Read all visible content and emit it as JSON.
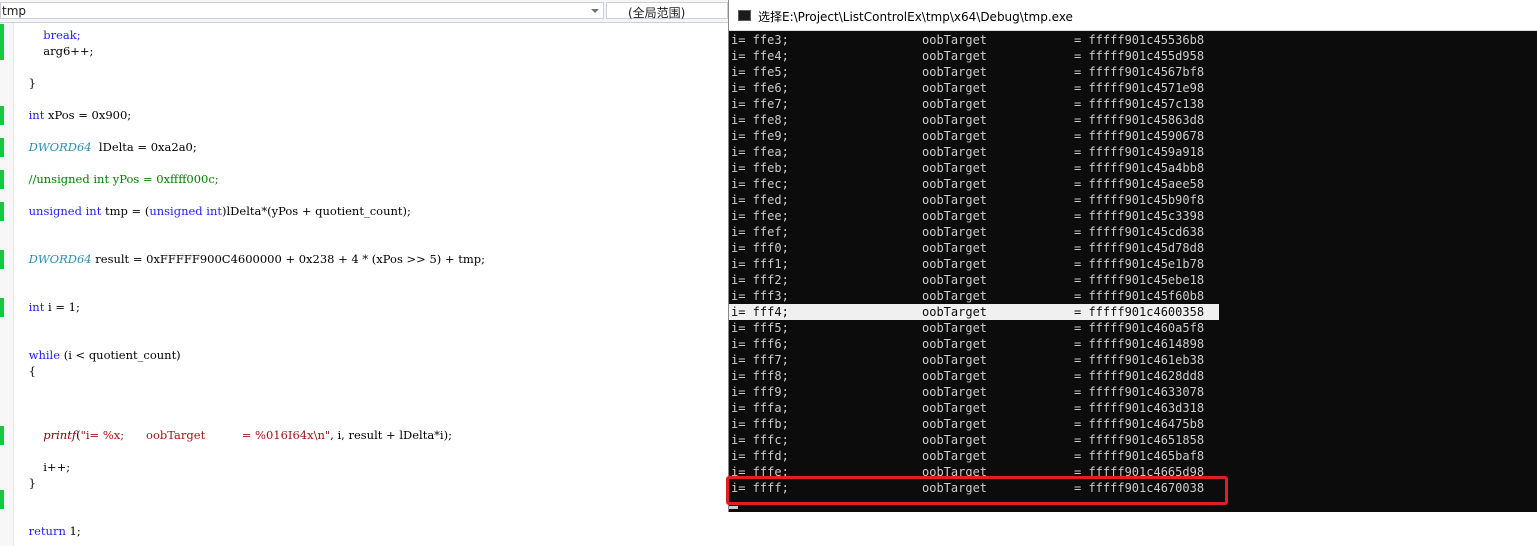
{
  "editor": {
    "file_combo": "tmp",
    "scope_combo": "(全局范围)",
    "code": {
      "break": "break;",
      "arg6": "arg6++;",
      "close_brace_1": "}",
      "xpos_kw": "int",
      "xpos_rest": " xPos = 0x900;",
      "delta_type": "DWORD64",
      "delta_rest": "  lDelta = 0xa2a0;",
      "comment": "//unsigned int yPos = 0xffff000c;",
      "tmp_kw1": "unsigned",
      "tmp_sp1": " ",
      "tmp_kw2": "int",
      "tmp_mid": " tmp = (",
      "tmp_kw3": "unsigned",
      "tmp_sp2": " ",
      "tmp_kw4": "int",
      "tmp_rest": ")lDelta*(yPos + quotient_count);",
      "result_type": "DWORD64",
      "result_rest": " result = 0xFFFFF900C4600000 + 0x238 + 4 * (xPos >> 5) + tmp;",
      "i_kw": "int",
      "i_rest": " i = 1;",
      "while_kw": "while",
      "while_rest": " (i < quotient_count)",
      "open_brace": "{",
      "printf_fn": "printf",
      "printf_open": "(",
      "printf_str": "\"i= %x;      oobTarget          = %016I64x\\n\"",
      "printf_rest": ", i, result + lDelta*i);",
      "incr": "i++;",
      "close_brace_2": "}",
      "return_kw": "return",
      "return_rest": " 1;"
    }
  },
  "console": {
    "title": "选择E:\\Project\\ListControlEx\\tmp\\x64\\Debug\\tmp.exe",
    "lines": [
      {
        "i": "i= ffe3;",
        "label": "oobTarget",
        "value": "= fffff901c45536b8"
      },
      {
        "i": "i= ffe4;",
        "label": "oobTarget",
        "value": "= fffff901c455d958"
      },
      {
        "i": "i= ffe5;",
        "label": "oobTarget",
        "value": "= fffff901c4567bf8"
      },
      {
        "i": "i= ffe6;",
        "label": "oobTarget",
        "value": "= fffff901c4571e98"
      },
      {
        "i": "i= ffe7;",
        "label": "oobTarget",
        "value": "= fffff901c457c138"
      },
      {
        "i": "i= ffe8;",
        "label": "oobTarget",
        "value": "= fffff901c45863d8"
      },
      {
        "i": "i= ffe9;",
        "label": "oobTarget",
        "value": "= fffff901c4590678"
      },
      {
        "i": "i= ffea;",
        "label": "oobTarget",
        "value": "= fffff901c459a918"
      },
      {
        "i": "i= ffeb;",
        "label": "oobTarget",
        "value": "= fffff901c45a4bb8"
      },
      {
        "i": "i= ffec;",
        "label": "oobTarget",
        "value": "= fffff901c45aee58"
      },
      {
        "i": "i= ffed;",
        "label": "oobTarget",
        "value": "= fffff901c45b90f8"
      },
      {
        "i": "i= ffee;",
        "label": "oobTarget",
        "value": "= fffff901c45c3398"
      },
      {
        "i": "i= ffef;",
        "label": "oobTarget",
        "value": "= fffff901c45cd638"
      },
      {
        "i": "i= fff0;",
        "label": "oobTarget",
        "value": "= fffff901c45d78d8"
      },
      {
        "i": "i= fff1;",
        "label": "oobTarget",
        "value": "= fffff901c45e1b78"
      },
      {
        "i": "i= fff2;",
        "label": "oobTarget",
        "value": "= fffff901c45ebe18"
      },
      {
        "i": "i= fff3;",
        "label": "oobTarget",
        "value": "= fffff901c45f60b8"
      },
      {
        "i": "i= fff4;",
        "label": "oobTarget",
        "value": "= fffff901c4600358"
      },
      {
        "i": "i= fff5;",
        "label": "oobTarget",
        "value": "= fffff901c460a5f8"
      },
      {
        "i": "i= fff6;",
        "label": "oobTarget",
        "value": "= fffff901c4614898"
      },
      {
        "i": "i= fff7;",
        "label": "oobTarget",
        "value": "= fffff901c461eb38"
      },
      {
        "i": "i= fff8;",
        "label": "oobTarget",
        "value": "= fffff901c4628dd8"
      },
      {
        "i": "i= fff9;",
        "label": "oobTarget",
        "value": "= fffff901c4633078"
      },
      {
        "i": "i= fffa;",
        "label": "oobTarget",
        "value": "= fffff901c463d318"
      },
      {
        "i": "i= fffb;",
        "label": "oobTarget",
        "value": "= fffff901c46475b8"
      },
      {
        "i": "i= fffc;",
        "label": "oobTarget",
        "value": "= fffff901c4651858"
      },
      {
        "i": "i= fffd;",
        "label": "oobTarget",
        "value": "= fffff901c465baf8"
      },
      {
        "i": "i= fffe;",
        "label": "oobTarget",
        "value": "= fffff901c4665d98"
      },
      {
        "i": "i= ffff;",
        "label": "oobTarget",
        "value": "= fffff901c4670038"
      }
    ]
  },
  "colors": {
    "keyword": "#1f1fff",
    "type": "#2b91af",
    "comment": "#008000",
    "string": "#a31515",
    "change_bar": "#18c940",
    "console_bg": "#0c0c0c",
    "console_text": "#cccccc",
    "highlight_box": "#e02020"
  }
}
